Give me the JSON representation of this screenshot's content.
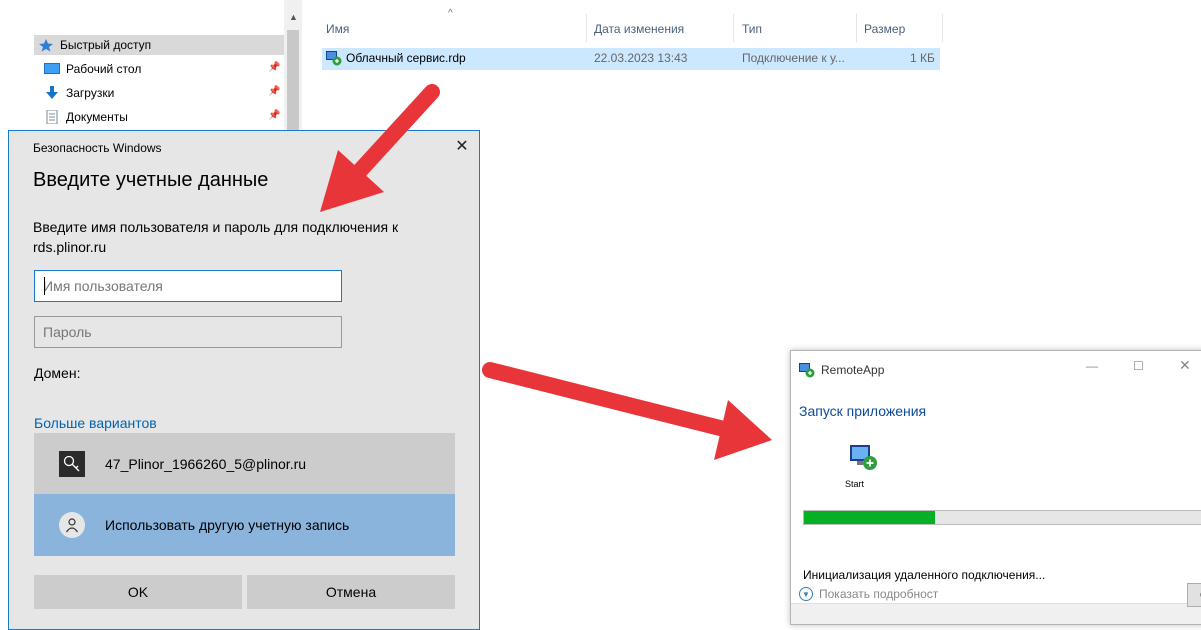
{
  "explorer": {
    "nav": {
      "quick_access": "Быстрый доступ",
      "items": [
        {
          "label": "Рабочий стол",
          "icon": "desktop-icon"
        },
        {
          "label": "Загрузки",
          "icon": "download-icon"
        },
        {
          "label": "Документы",
          "icon": "documents-icon"
        }
      ]
    },
    "columns": {
      "name": "Имя",
      "date": "Дата изменения",
      "type": "Тип",
      "size": "Размер"
    },
    "file": {
      "name": "Облачный сервис.rdp",
      "date": "22.03.2023 13:43",
      "type": "Подключение к у...",
      "size": "1 КБ"
    }
  },
  "security_dialog": {
    "title": "Безопасность Windows",
    "heading": "Введите учетные данные",
    "description": "Введите имя пользователя и пароль для подключения к rds.plinor.ru",
    "username_placeholder": "Имя пользователя",
    "password_placeholder": "Пароль",
    "domain_label": "Домен:",
    "more_options": "Больше вариантов",
    "accounts": [
      {
        "label": "47_Plinor_1966260_5@plinor.ru",
        "icon": "key-icon"
      },
      {
        "label": "Использовать другую учетную запись",
        "icon": "user-icon"
      }
    ],
    "ok_label": "OK",
    "cancel_label": "Отмена"
  },
  "remoteapp": {
    "title": "RemoteApp",
    "heading": "Запуск приложения",
    "app_name": "Start",
    "progress_fraction": 0.33,
    "status": "Инициализация удаленного подключения...",
    "details_label": "Показать подробност",
    "button_label": "О"
  },
  "colors": {
    "accent": "#1979ca",
    "selection": "#cce8ff",
    "progress": "#06b025",
    "arrow": "#e8353a",
    "account_selected": "#8ab4dc"
  }
}
